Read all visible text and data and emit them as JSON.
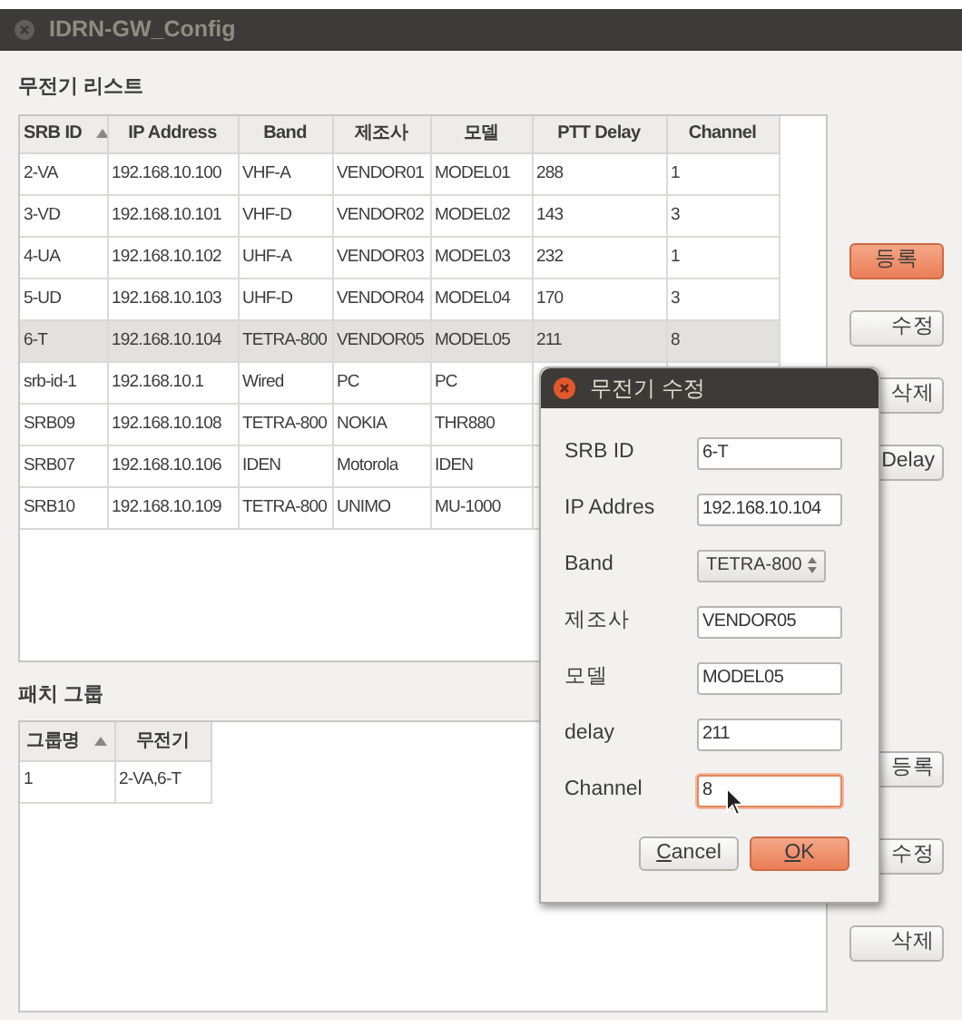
{
  "window": {
    "title": "IDRN-GW_Config"
  },
  "radio_list": {
    "title": "무전기 리스트",
    "columns": [
      {
        "label": "SRB ID",
        "sorted": true
      },
      {
        "label": "IP Address",
        "sorted": false
      },
      {
        "label": "Band",
        "sorted": false
      },
      {
        "label": "제조사",
        "sorted": false
      },
      {
        "label": "모델",
        "sorted": false
      },
      {
        "label": "PTT Delay",
        "sorted": false
      },
      {
        "label": "Channel",
        "sorted": false
      }
    ],
    "rows": [
      {
        "cells": [
          "2-VA",
          "192.168.10.100",
          "VHF-A",
          "VENDOR01",
          "MODEL01",
          "288",
          "1"
        ],
        "selected": false
      },
      {
        "cells": [
          "3-VD",
          "192.168.10.101",
          "VHF-D",
          "VENDOR02",
          "MODEL02",
          "143",
          "3"
        ],
        "selected": false
      },
      {
        "cells": [
          "4-UA",
          "192.168.10.102",
          "UHF-A",
          "VENDOR03",
          "MODEL03",
          "232",
          "1"
        ],
        "selected": false
      },
      {
        "cells": [
          "5-UD",
          "192.168.10.103",
          "UHF-D",
          "VENDOR04",
          "MODEL04",
          "170",
          "3"
        ],
        "selected": false
      },
      {
        "cells": [
          "6-T",
          "192.168.10.104",
          "TETRA-800",
          "VENDOR05",
          "MODEL05",
          "211",
          "8"
        ],
        "selected": true
      },
      {
        "cells": [
          "srb-id-1",
          "192.168.10.1",
          "Wired",
          "PC",
          "PC"
        ],
        "selected": false
      },
      {
        "cells": [
          "SRB09",
          "192.168.10.108",
          "TETRA-800",
          "NOKIA",
          "THR880"
        ],
        "selected": false
      },
      {
        "cells": [
          "SRB07",
          "192.168.10.106",
          "IDEN",
          "Motorola",
          "IDEN"
        ],
        "selected": false
      },
      {
        "cells": [
          "SRB10",
          "192.168.10.109",
          "TETRA-800",
          "UNIMO",
          "MU-1000"
        ],
        "selected": false
      }
    ]
  },
  "radio_buttons": [
    {
      "label": "등록",
      "kind": "primary"
    },
    {
      "label": "수정",
      "kind": "default"
    },
    {
      "label": "삭제",
      "kind": "default"
    },
    {
      "label": "Delay",
      "kind": "default"
    }
  ],
  "patch_group": {
    "title": "패치 그룹",
    "columns": [
      {
        "label": "그룹명",
        "sorted": true
      },
      {
        "label": "무전기",
        "sorted": false
      }
    ],
    "rows": [
      {
        "cells": [
          "1",
          "2-VA,6-T"
        ],
        "selected": false
      }
    ]
  },
  "group_buttons": [
    {
      "label": "등록",
      "kind": "default"
    },
    {
      "label": "수정",
      "kind": "default"
    },
    {
      "label": "삭제",
      "kind": "default"
    }
  ],
  "dialog": {
    "title": "무전기 수정",
    "fields": [
      {
        "label": "SRB ID",
        "kind": "text",
        "value": "6-T",
        "focused": false
      },
      {
        "label": "IP Addres",
        "kind": "text",
        "value": "192.168.10.104",
        "focused": false
      },
      {
        "label": "Band",
        "kind": "spin",
        "value": "TETRA-800",
        "focused": false
      },
      {
        "label": "제조사",
        "kind": "text",
        "value": "VENDOR05",
        "focused": false
      },
      {
        "label": "모델",
        "kind": "text",
        "value": "MODEL05",
        "focused": false
      },
      {
        "label": "delay",
        "kind": "text",
        "value": "211",
        "focused": false
      },
      {
        "label": "Channel",
        "kind": "text",
        "value": "8",
        "focused": true
      }
    ],
    "buttons": [
      {
        "label": "Cancel",
        "kind": "default"
      },
      {
        "label": "OK",
        "kind": "primary"
      }
    ]
  }
}
